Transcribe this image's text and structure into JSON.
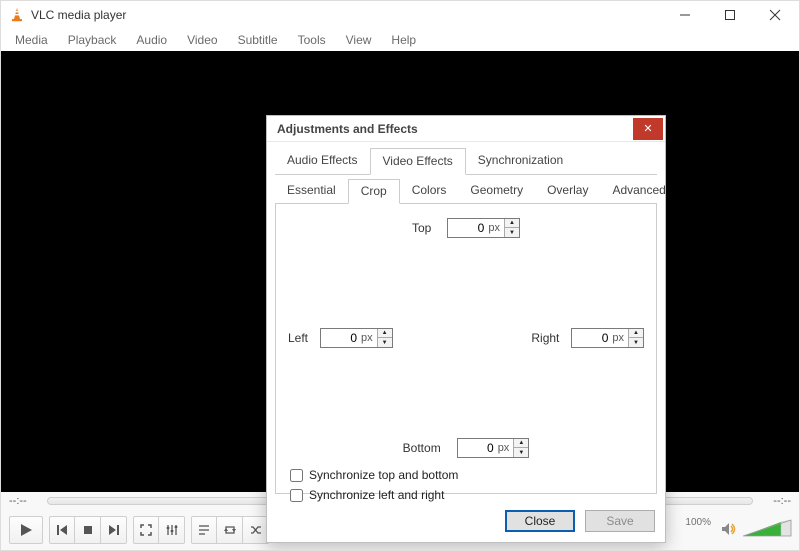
{
  "title": "VLC media player",
  "menu": [
    "Media",
    "Playback",
    "Audio",
    "Video",
    "Subtitle",
    "Tools",
    "View",
    "Help"
  ],
  "dialog": {
    "title": "Adjustments and Effects",
    "tabs1": {
      "items": [
        "Audio Effects",
        "Video Effects",
        "Synchronization"
      ],
      "active": "Video Effects"
    },
    "tabs2": {
      "items": [
        "Essential",
        "Crop",
        "Colors",
        "Geometry",
        "Overlay",
        "Advanced"
      ],
      "active": "Crop"
    },
    "crop": {
      "labels": {
        "top": "Top",
        "bottom": "Bottom",
        "left": "Left",
        "right": "Right"
      },
      "unit": "px",
      "values": {
        "top": "0",
        "bottom": "0",
        "left": "0",
        "right": "0"
      },
      "sync_tb_label": "Synchronize top and bottom",
      "sync_lr_label": "Synchronize left and right",
      "sync_tb": false,
      "sync_lr": false
    },
    "buttons": {
      "close": "Close",
      "save": "Save"
    }
  },
  "seek": {
    "elapsed": "--:--",
    "remaining": "--:--"
  },
  "volume": {
    "percent_label": "100%",
    "value": 100
  }
}
